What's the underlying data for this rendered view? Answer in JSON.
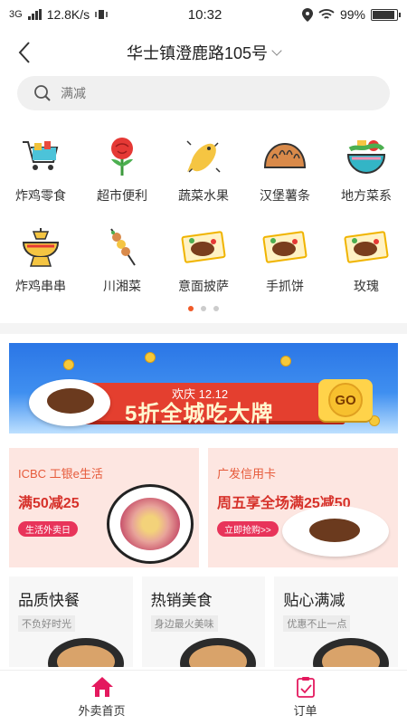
{
  "status": {
    "network": "3G",
    "speed": "12.8K/s",
    "time": "10:32",
    "battery": "99%"
  },
  "header": {
    "address": "华士镇澄鹿路105号"
  },
  "search": {
    "placeholder": "满减"
  },
  "categories": [
    {
      "label": "炸鸡零食",
      "icon": "shopping-cart-icon"
    },
    {
      "label": "超市便利",
      "icon": "rose-icon"
    },
    {
      "label": "蔬菜水果",
      "icon": "fish-icon"
    },
    {
      "label": "汉堡薯条",
      "icon": "dumpling-icon"
    },
    {
      "label": "地方菜系",
      "icon": "salad-bowl-icon"
    },
    {
      "label": "炸鸡串串",
      "icon": "hotpot-icon"
    },
    {
      "label": "川湘菜",
      "icon": "skewer-icon"
    },
    {
      "label": "意面披萨",
      "icon": "steak-plate-icon"
    },
    {
      "label": "手抓饼",
      "icon": "steak-plate-icon"
    },
    {
      "label": "玫瑰",
      "icon": "steak-plate-icon"
    }
  ],
  "pager": {
    "count": 3,
    "active": 0
  },
  "banner": {
    "subtitle": "欢庆 12.12",
    "headline": "5折全城吃大牌",
    "button": "GO"
  },
  "promos": [
    {
      "brand": "ICBC 工银e生活",
      "headline": "满50减25",
      "pill": "生活外卖日"
    },
    {
      "brand": "广发信用卡",
      "headline": "周五享全场满25减50",
      "pill": "立即抢购>>"
    }
  ],
  "cards": [
    {
      "title": "品质快餐",
      "subtitle": "不负好时光"
    },
    {
      "title": "热销美食",
      "subtitle": "身边最火美味"
    },
    {
      "title": "贴心满减",
      "subtitle": "优惠不止一点"
    }
  ],
  "tabs": [
    {
      "label": "外卖首页",
      "active": true,
      "color": "#e4195e"
    },
    {
      "label": "订单",
      "active": false,
      "color": "#e4195e"
    }
  ]
}
